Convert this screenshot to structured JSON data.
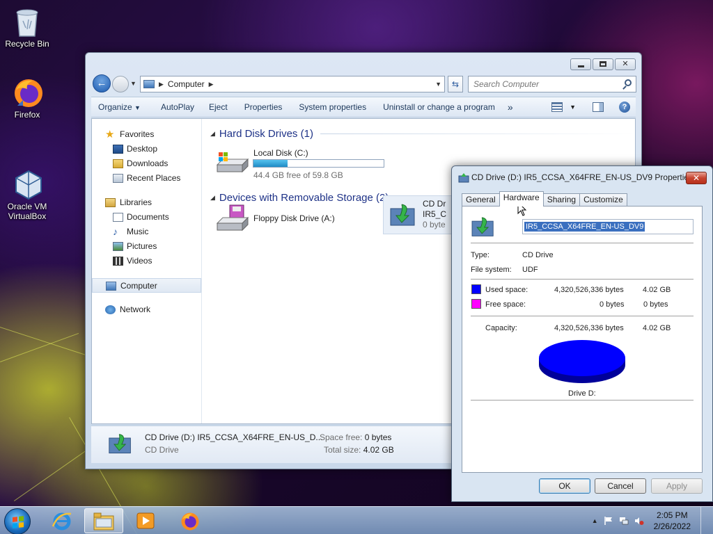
{
  "desktop": {
    "icons": [
      {
        "label": "Recycle Bin"
      },
      {
        "label": "Firefox"
      },
      {
        "label": "Oracle VM\nVirtualBox"
      }
    ]
  },
  "explorer": {
    "address": {
      "path": "Computer"
    },
    "search": {
      "placeholder": "Search Computer"
    },
    "toolbar": {
      "organize": "Organize",
      "autoplay": "AutoPlay",
      "eject": "Eject",
      "properties": "Properties",
      "system_properties": "System properties",
      "uninstall": "Uninstall or change a program",
      "more": "»"
    },
    "nav": {
      "favorites": "Favorites",
      "desktop": "Desktop",
      "downloads": "Downloads",
      "recent": "Recent Places",
      "libraries": "Libraries",
      "documents": "Documents",
      "music": "Music",
      "pictures": "Pictures",
      "videos": "Videos",
      "computer": "Computer",
      "network": "Network"
    },
    "groups": {
      "hdd_title": "Hard Disk Drives (1)",
      "removable_title": "Devices with Removable Storage (2)"
    },
    "drives": {
      "c": {
        "name": "Local Disk (C:)",
        "free": "44.4 GB free of 59.8 GB",
        "used_fraction": 0.26
      },
      "a": {
        "name": "Floppy Disk Drive (A:)"
      },
      "d": {
        "name_l1": "CD Dr",
        "name_l2": "IR5_C",
        "free": "0 byte"
      }
    },
    "details": {
      "name": "CD Drive (D:) IR5_CCSA_X64FRE_EN-US_D...",
      "type": "CD Drive",
      "space_free_label": "Space free:",
      "space_free_value": "0 bytes",
      "total_size_label": "Total size:",
      "total_size_value": "4.02 GB"
    }
  },
  "dialog": {
    "title": "CD Drive (D:) IR5_CCSA_X64FRE_EN-US_DV9 Properties",
    "close": "✕",
    "tabs": [
      "General",
      "Hardware",
      "Sharing",
      "Customize"
    ],
    "volume_label": "IR5_CCSA_X64FRE_EN-US_DV9",
    "type_label": "Type:",
    "type_value": "CD Drive",
    "fs_label": "File system:",
    "fs_value": "UDF",
    "used_label": "Used space:",
    "used_bytes": "4,320,526,336 bytes",
    "used_gb": "4.02 GB",
    "free_label": "Free space:",
    "free_bytes": "0 bytes",
    "free_gb": "0 bytes",
    "capacity_label": "Capacity:",
    "capacity_bytes": "4,320,526,336 bytes",
    "capacity_gb": "4.02 GB",
    "drive_label": "Drive D:",
    "ok": "OK",
    "cancel": "Cancel",
    "apply": "Apply",
    "colors": {
      "used": "#0000ff",
      "free": "#ff00ff"
    }
  },
  "taskbar": {
    "time": "2:05 PM",
    "date": "2/26/2022"
  }
}
